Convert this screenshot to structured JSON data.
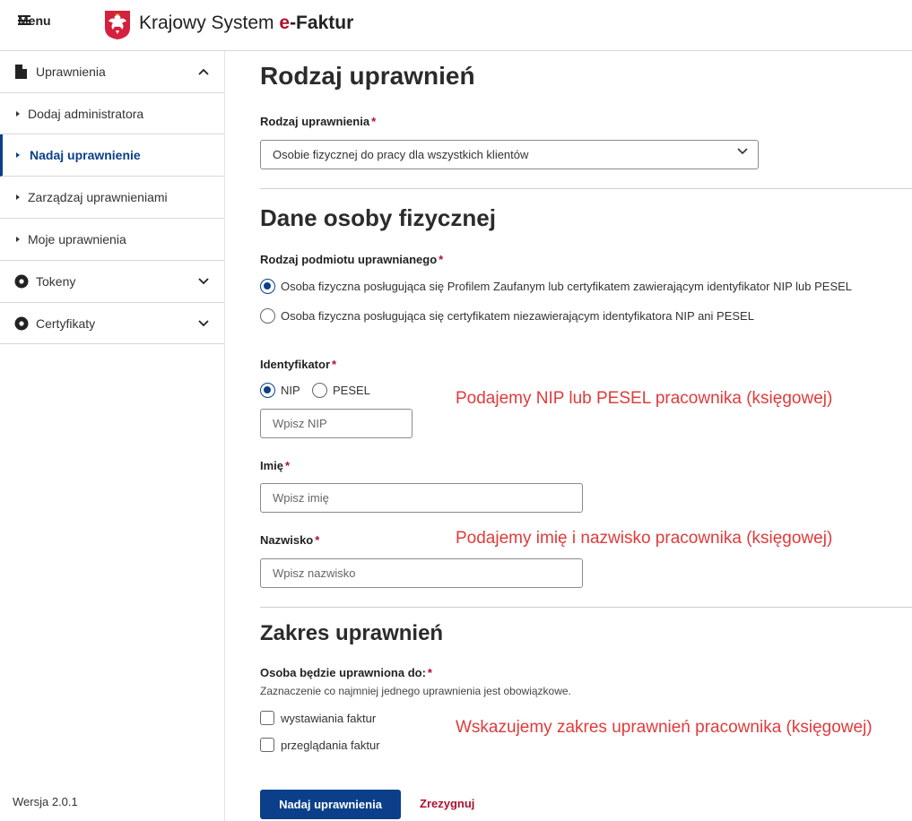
{
  "header": {
    "menu_label": "Menu",
    "brand_prefix": "Krajowy System ",
    "brand_accent": "e",
    "brand_suffix": "-Faktur"
  },
  "sidebar": {
    "items": [
      {
        "label": "Uprawnienia",
        "icon": "document-icon",
        "expanded": true
      },
      {
        "label": "Dodaj administratora"
      },
      {
        "label": "Nadaj uprawnienie",
        "active": true
      },
      {
        "label": "Zarządzaj uprawnieniami"
      },
      {
        "label": "Moje uprawnienia"
      },
      {
        "label": "Tokeny",
        "icon": "circle-icon",
        "expanded": false
      },
      {
        "label": "Certyfikaty",
        "icon": "circle-icon",
        "expanded": false
      }
    ],
    "version": "Wersja 2.0.1"
  },
  "main": {
    "section1_title": "Rodzaj uprawnień",
    "permission_type_label": "Rodzaj uprawnienia",
    "permission_type_value": "Osobie fizycznej do pracy dla wszystkich klientów",
    "section2_title": "Dane osoby fizycznej",
    "subject_type_label": "Rodzaj podmiotu uprawnianego",
    "subject_options": [
      {
        "label": "Osoba fizyczna posługująca się Profilem Zaufanym lub certyfikatem zawierającym identyfikator NIP lub PESEL",
        "selected": true
      },
      {
        "label": "Osoba fizyczna posługująca się certyfikatem niezawierającym identyfikatora NIP ani PESEL",
        "selected": false
      }
    ],
    "identifier_label": "Identyfikator",
    "identifier_options": [
      {
        "label": "NIP",
        "selected": true
      },
      {
        "label": "PESEL",
        "selected": false
      }
    ],
    "nip_placeholder": "Wpisz NIP",
    "first_name_label": "Imię",
    "first_name_placeholder": "Wpisz imię",
    "last_name_label": "Nazwisko",
    "last_name_placeholder": "Wpisz nazwisko",
    "section3_title": "Zakres uprawnień",
    "scope_label": "Osoba będzie uprawniona do:",
    "scope_hint": "Zaznaczenie co najmniej jednego uprawnienia jest obowiązkowe.",
    "scope_options": [
      {
        "label": "wystawiania faktur",
        "checked": false
      },
      {
        "label": "przeglądania faktur",
        "checked": false
      }
    ],
    "submit_label": "Nadaj uprawnienia",
    "cancel_label": "Zrezygnuj",
    "required_mark": "*"
  },
  "annotations": [
    "Podajemy NIP lub PESEL pracownika (księgowej)",
    "Podajemy imię i nazwisko pracownika (księgowej)",
    "Wskazujemy zakres uprawnień pracownika (księgowej)"
  ],
  "colors": {
    "primary": "#0b3f8a",
    "accent_red": "#b0102e",
    "annotation": "#e03b3b"
  }
}
